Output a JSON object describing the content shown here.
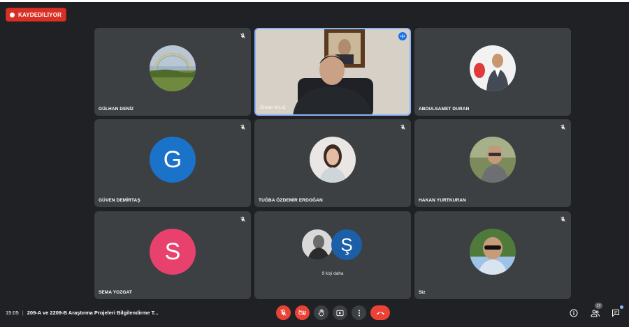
{
  "recording": {
    "label": "KAYDEDİLİYOR"
  },
  "tiles": [
    {
      "name": "GÜLHAN DENİZ",
      "type": "photo",
      "muted": true
    },
    {
      "name": "Önder KILIÇ",
      "type": "video",
      "speaking": true
    },
    {
      "name": "ABDULSAMET DURAN",
      "type": "photo",
      "muted": false
    },
    {
      "name": "GÜVEN DEMİRTAŞ",
      "type": "letter",
      "letter": "G",
      "color": "#1a73c9",
      "muted": true
    },
    {
      "name": "TUĞBA ÖZDEMİR ERDOĞAN",
      "type": "photo",
      "muted": true
    },
    {
      "name": "HAKAN YURTKURAN",
      "type": "photo",
      "muted": true
    },
    {
      "name": "SEMA YOZGAT",
      "type": "letter",
      "letter": "S",
      "color": "#e8416d",
      "muted": true
    },
    {
      "name": "",
      "type": "others",
      "letter": "Ş",
      "label": "9 kişi daha"
    },
    {
      "name": "Siz",
      "type": "photo",
      "muted": true
    }
  ],
  "bottom": {
    "time": "15:05",
    "meeting_title": "209-A ve 2209-B Araştırma Projeleri Bilgilendirme T...",
    "participant_count": "17"
  },
  "icons": {
    "mic_off": "mic-off-icon",
    "cam_off": "camera-off-icon",
    "hand": "raise-hand-icon",
    "present": "present-icon",
    "more": "more-vert-icon",
    "hangup": "hangup-icon",
    "info": "info-icon",
    "people": "people-icon",
    "chat": "chat-icon"
  },
  "colors": {
    "record": "#d93025",
    "danger": "#ea4335",
    "active_border": "#8ab4f8"
  }
}
